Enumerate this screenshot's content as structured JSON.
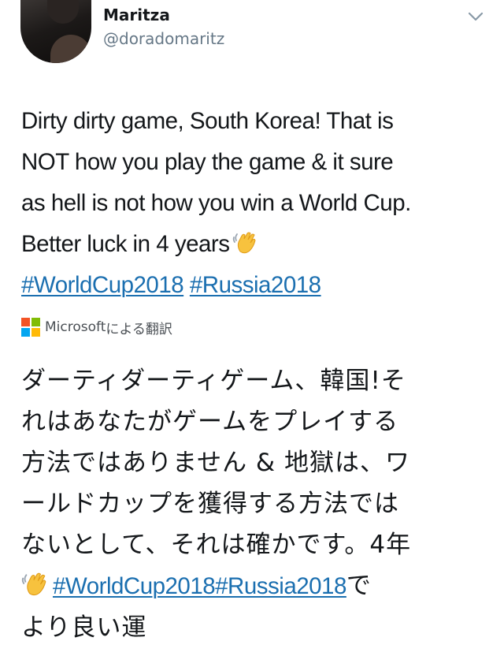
{
  "user": {
    "display_name": "Maritza",
    "handle": "@doradomaritz"
  },
  "icons": {
    "caret": "chevron-down-icon",
    "wave": "waving-hand-emoji",
    "translate_logo": "microsoft-logo-icon"
  },
  "tweet": {
    "lines": [
      "Dirty dirty game, South Korea! That is",
      "NOT how you play the game & it sure",
      "as hell is not how you win a World Cup.",
      "Better luck in 4 years"
    ],
    "hashtags": [
      "#WorldCup2018",
      "#Russia2018"
    ]
  },
  "translation": {
    "provider": "Microsoft",
    "label_suffix": "による翻訳",
    "lines": [
      "ダーティダーティゲーム、韓国!そ",
      "れはあなたがゲームをプレイする",
      "方法ではありません & 地獄は、ワ",
      "ールドカップを獲得する方法では",
      "ないとして、それは確かです。4年"
    ],
    "hashtags_line": "#WorldCup2018#Russia2018",
    "hashtags_suffix": "で",
    "last_line": "より良い運"
  },
  "colors": {
    "link": "#1b6fb0",
    "secondary_text": "#657786",
    "primary_text": "#14171a",
    "ms_red": "#f35325",
    "ms_green": "#81bc06",
    "ms_blue": "#05a6f0",
    "ms_yellow": "#ffba08"
  }
}
